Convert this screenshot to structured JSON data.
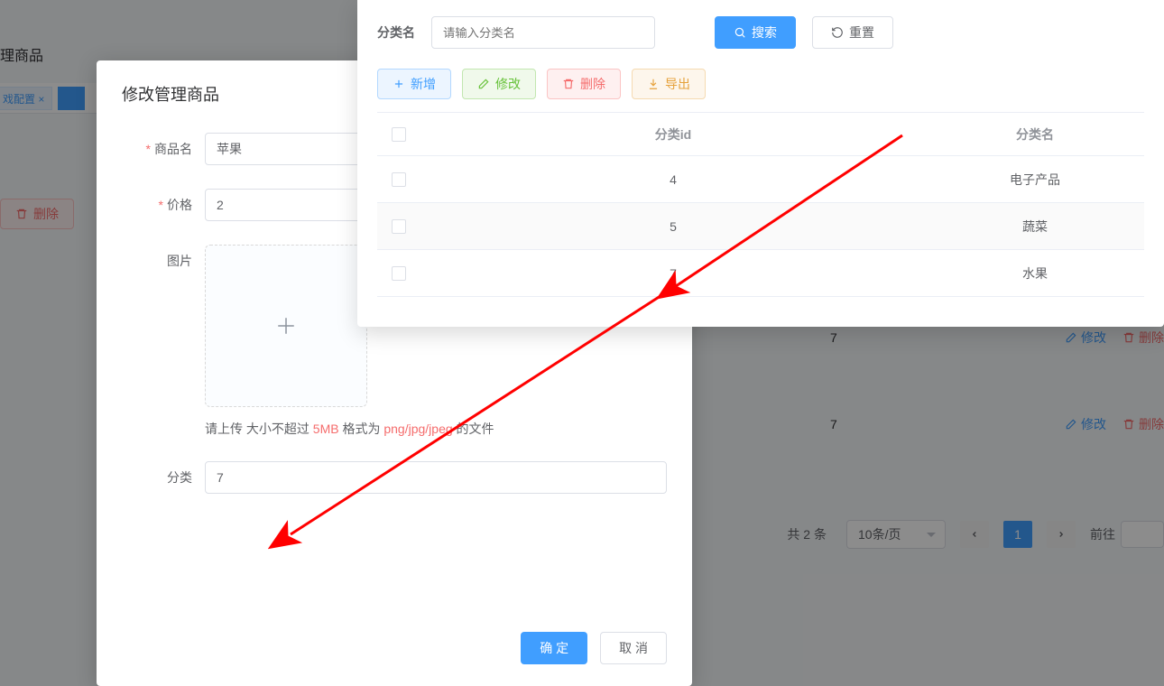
{
  "background": {
    "title_fragment": "理商品",
    "tab_left": "戏配置 ×",
    "delete_label": "删除",
    "rows": [
      {
        "cat_id": "7",
        "edit": "修改",
        "del": "删除"
      },
      {
        "cat_id": "7",
        "edit": "修改",
        "del": "删除"
      }
    ],
    "pagination": {
      "total": "共 2 条",
      "page_size": "10条/页",
      "current": "1",
      "goto_label": "前往"
    }
  },
  "dialog": {
    "title": "修改管理商品",
    "fields": {
      "name_label": "商品名",
      "name_value": "苹果",
      "price_label": "价格",
      "price_value": "2",
      "image_label": "图片",
      "category_label": "分类",
      "category_value": "7"
    },
    "upload_tip": {
      "p1": "请上传 大小不超过 ",
      "size": "5MB",
      "p2": " 格式为 ",
      "fmt": "png/jpg/jpeg",
      "p3": " 的文件"
    },
    "ok": "确 定",
    "cancel": "取 消"
  },
  "panel": {
    "filter_label": "分类名",
    "filter_placeholder": "请输入分类名",
    "search": "搜索",
    "reset": "重置",
    "toolbar": {
      "add": "新增",
      "edit": "修改",
      "del": "删除",
      "exp": "导出"
    },
    "columns": {
      "id": "分类id",
      "name": "分类名"
    },
    "rows": [
      {
        "id": "4",
        "name": "电子产品"
      },
      {
        "id": "5",
        "name": "蔬菜"
      },
      {
        "id": "7",
        "name": "水果"
      }
    ]
  }
}
